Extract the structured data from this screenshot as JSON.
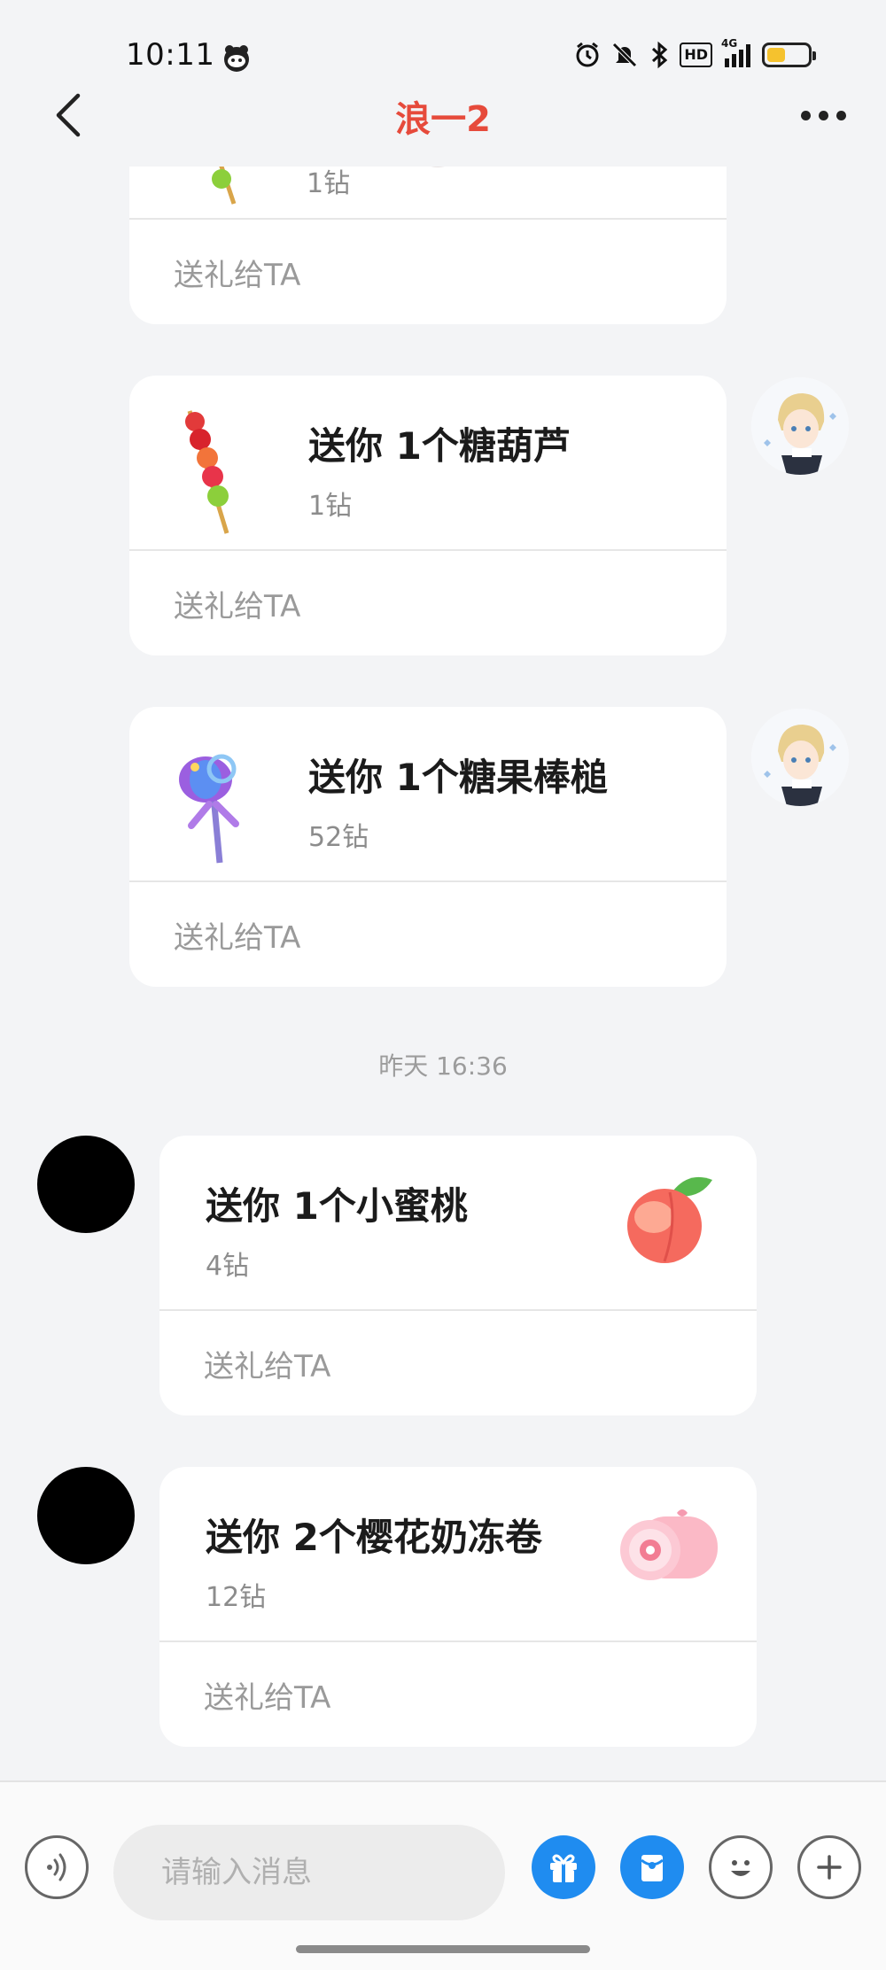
{
  "status_bar": {
    "time": "10:11",
    "network": "4G",
    "hd": "HD",
    "battery_level": 0.45,
    "battery_color": "#f5c22e"
  },
  "nav": {
    "title": "浪一2",
    "title_color": "#e64a3b"
  },
  "messages": [
    {
      "title": "",
      "price": "1钻",
      "send_label": "送礼给TA",
      "item_icon": "candied-haws-icon"
    },
    {
      "title": "送你 1个糖葫芦",
      "price": "1钻",
      "send_label": "送礼给TA",
      "item_icon": "candied-haws-icon"
    },
    {
      "title": "送你 1个糖果棒槌",
      "price": "52钻",
      "send_label": "送礼给TA",
      "item_icon": "candy-mallet-icon"
    },
    {
      "title": "送你 1个小蜜桃",
      "price": "4钻",
      "send_label": "送礼给TA",
      "item_icon": "peach-icon"
    },
    {
      "title": "送你 2个樱花奶冻卷",
      "price": "12钻",
      "send_label": "送礼给TA",
      "item_icon": "sakura-roll-icon"
    }
  ],
  "timestamp": "昨天 16:36",
  "input": {
    "placeholder": "请输入消息"
  },
  "toolbar": {
    "voice_icon": "voice-icon",
    "gift_icon": "gift-icon",
    "red_packet_icon": "red-packet-icon",
    "emoji_icon": "emoji-icon",
    "plus_icon": "plus-icon",
    "accent": "#1f8cf0"
  }
}
